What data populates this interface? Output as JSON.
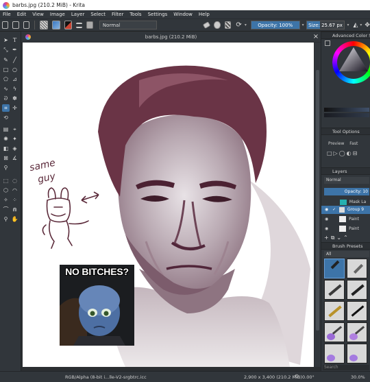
{
  "window": {
    "title": "barbs.jpg (210.2 MiB)  - Krita"
  },
  "menu": [
    "File",
    "Edit",
    "View",
    "Image",
    "Layer",
    "Select",
    "Filter",
    "Tools",
    "Settings",
    "Window",
    "Help"
  ],
  "toolbar": {
    "blend_mode": "Normal",
    "opacity_label": "Opacity: 100%",
    "opacity": 1.0,
    "size_label": "Size: 25.67 px",
    "size_fill": 0.35
  },
  "document": {
    "tab_title": "barbs.jpg (210.2 MiB)"
  },
  "canvas": {
    "doodle_text_line1": "same",
    "doodle_text_line2": "guy",
    "meme_text": "NO BITCHES?"
  },
  "dock": {
    "color_selector": "Advanced Color Selector",
    "tool_options": "Tool Options",
    "tool_preview": "Preview",
    "tool_fast": "Fast",
    "layers": "Layers",
    "layer_blend": "Normal",
    "layer_opacity": "Opacity: 10",
    "layers_list": [
      {
        "name": "Mask La"
      },
      {
        "name": "Group 9"
      },
      {
        "name": "Paint"
      },
      {
        "name": "Paint"
      }
    ],
    "brush_presets": "Brush Presets",
    "brush_tag": "All",
    "search_placeholder": "Search"
  },
  "status": {
    "color_profile": "RGB/Alpha (8-bit i...lle-V2-srgbtrc.icc",
    "dimensions": "2,900 x 3,400 (210.2 MiB)",
    "rotation": "0.00°",
    "zoom": "30.0%"
  },
  "colors": {
    "accent": "#3d74a8",
    "ui_bg": "#31363b",
    "ink": "#5b2a3a"
  }
}
